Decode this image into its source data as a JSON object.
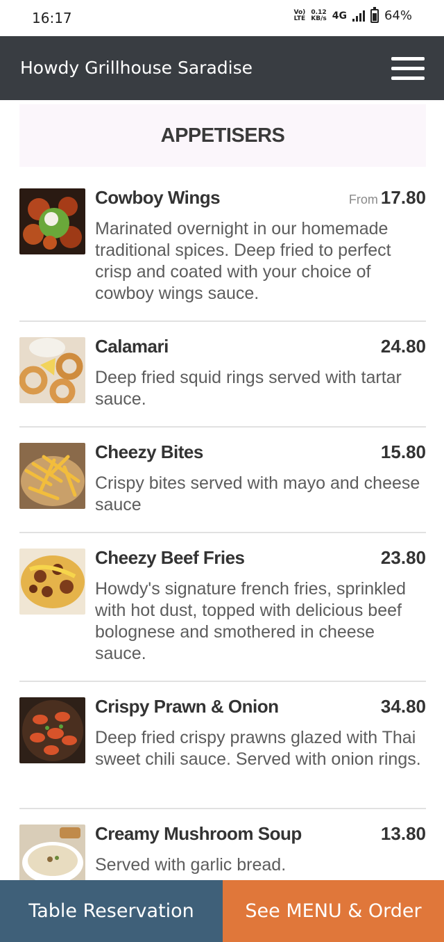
{
  "status_bar": {
    "time": "16:17",
    "volte_top": "Vo)",
    "volte_bottom": "LTE",
    "speed_value": "0.12",
    "speed_unit": "KB/s",
    "network": "4G",
    "battery": "64%",
    "battery_level": 0.64
  },
  "header": {
    "title": "Howdy Grillhouse Saradise",
    "menu_icon": "hamburger-menu-icon"
  },
  "section": {
    "title": "APPETISERS"
  },
  "items": [
    {
      "name": "Cowboy Wings",
      "price_prefix": "From",
      "price": "17.80",
      "description": "Marinated overnight in our homemade traditional spices. Deep fried to perfect crisp and coated with your choice of cowboy wings sauce."
    },
    {
      "name": "Calamari",
      "price": "24.80",
      "description": "Deep fried squid rings served with tartar sauce."
    },
    {
      "name": "Cheezy Bites",
      "price": "15.80",
      "description": "Crispy bites served with mayo and cheese sauce"
    },
    {
      "name": "Cheezy Beef Fries",
      "price": "23.80",
      "description": "Howdy's signature french fries, sprinkled with hot dust, topped with delicious beef bolognese and smothered in cheese sauce."
    },
    {
      "name": "Crispy Prawn & Onion",
      "price": "34.80",
      "description": "Deep fried crispy prawns glazed with Thai sweet chili sauce. Served with onion rings."
    },
    {
      "name": "Creamy Mushroom Soup",
      "price": "13.80",
      "description": "Served with garlic bread."
    }
  ],
  "footer": {
    "reserve_label": "Table Reservation",
    "order_label": "See MENU & Order"
  },
  "colors": {
    "header_bg": "#393d42",
    "reserve_bg": "#3f6079",
    "order_bg": "#e0773a",
    "section_bg": "#fbf6fb"
  }
}
